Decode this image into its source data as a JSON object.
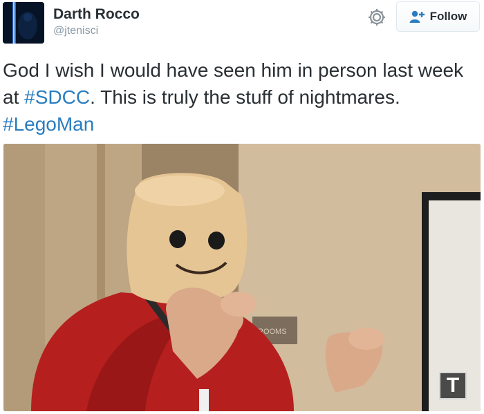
{
  "user": {
    "display_name": "Darth Rocco",
    "handle": "@jtenisci"
  },
  "actions": {
    "settings_icon": "gear-icon",
    "follow_label": "Follow",
    "follow_icon": "add-user-icon"
  },
  "tweet": {
    "segments": [
      {
        "text": "God I wish I would have seen him in person last week at ",
        "type": "text"
      },
      {
        "text": "#SDCC",
        "type": "hashtag"
      },
      {
        "text": ". This is truly the stuff of nightmares. ",
        "type": "text"
      },
      {
        "text": "#LegoMan",
        "type": "hashtag"
      }
    ]
  },
  "media": {
    "sign_text": "ROOMS",
    "watermark": "T"
  },
  "colors": {
    "link": "#2a7dc0",
    "text": "#292f33",
    "muted": "#8899a6"
  }
}
